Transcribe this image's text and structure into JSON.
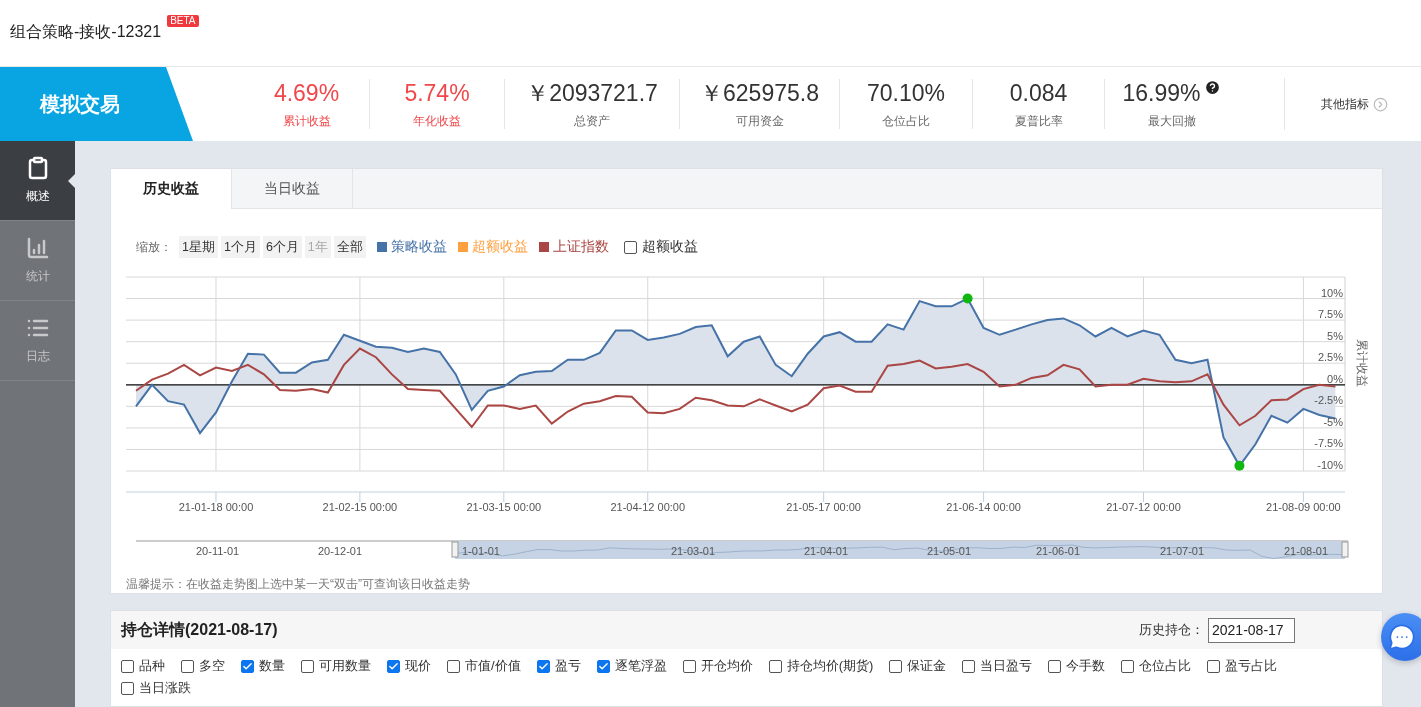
{
  "page": {
    "title": "组合策略-接收-12321",
    "badge": "BETA"
  },
  "banner": {
    "title": "模拟交易"
  },
  "metrics": [
    {
      "value": "4.69%",
      "label": "累计收益",
      "color": "#f0474a",
      "info": false
    },
    {
      "value": "5.74%",
      "label": "年化收益",
      "color": "#f0474a",
      "info": false
    },
    {
      "value": "￥2093721.7",
      "label": "总资产",
      "color": "#333333",
      "info": false
    },
    {
      "value": "￥625975.8",
      "label": "可用资金",
      "color": "#333333",
      "info": false
    },
    {
      "value": "70.10%",
      "label": "仓位占比",
      "color": "#333333",
      "info": false
    },
    {
      "value": "0.084",
      "label": "夏普比率",
      "color": "#333333",
      "info": false
    },
    {
      "value": "16.99%",
      "label": "最大回撤",
      "color": "#333333",
      "info": true
    }
  ],
  "other_metrics": {
    "label": "其他指标"
  },
  "sidebar": {
    "items": [
      {
        "label": "概述",
        "kind": "overview",
        "selected": true
      },
      {
        "label": "统计",
        "kind": "stats",
        "selected": false
      },
      {
        "label": "日志",
        "kind": "log",
        "selected": false
      }
    ]
  },
  "chart_panel": {
    "tabs": [
      {
        "label": "历史收益",
        "selected": true
      },
      {
        "label": "当日收益",
        "selected": false
      }
    ],
    "zoom": {
      "label": "缩放：",
      "buttons": [
        {
          "label": "1星期",
          "disabled": false
        },
        {
          "label": "1个月",
          "disabled": false
        },
        {
          "label": "6个月",
          "disabled": false
        },
        {
          "label": "1年",
          "disabled": true
        },
        {
          "label": "全部",
          "disabled": false
        }
      ]
    },
    "excess_toggle": {
      "label": "超额收益",
      "checked": false
    },
    "legend_extra": {
      "label": "超额收益",
      "color": "#ffa040"
    },
    "chart_data": {
      "type": "line",
      "ylabel": "累计收益",
      "grid": true,
      "categories": [
        null,
        null,
        null,
        null,
        null,
        "21-01-18 00:00",
        null,
        null,
        null,
        null,
        null,
        null,
        null,
        null,
        "21-02-15 00:00",
        null,
        null,
        null,
        null,
        null,
        null,
        null,
        null,
        "21-03-15 00:00",
        null,
        null,
        null,
        null,
        null,
        null,
        null,
        null,
        "21-04-12 00:00",
        null,
        null,
        null,
        null,
        null,
        null,
        null,
        null,
        null,
        null,
        "21-05-17 00:00",
        null,
        null,
        null,
        null,
        null,
        null,
        null,
        null,
        null,
        "21-06-14 00:00",
        null,
        null,
        null,
        null,
        null,
        null,
        null,
        null,
        null,
        "21-07-12 00:00",
        null,
        null,
        null,
        null,
        null,
        null,
        null,
        null,
        null,
        "21-08-09 00:00",
        null,
        null
      ],
      "ylim": [
        -10,
        12.5
      ],
      "yticks": [
        {
          "value": 10,
          "label": "10%"
        },
        {
          "value": 7.5,
          "label": "7.5%"
        },
        {
          "value": 5,
          "label": "5%"
        },
        {
          "value": 2.5,
          "label": "2.5%"
        },
        {
          "value": 0,
          "label": "0%"
        },
        {
          "value": -2.5,
          "label": "-2.5%"
        },
        {
          "value": -5,
          "label": "-5%"
        },
        {
          "value": -7.5,
          "label": "-7.5%"
        },
        {
          "value": -10,
          "label": "-10%"
        }
      ],
      "series": [
        {
          "name": "策略收益",
          "color": "#4572a7",
          "values": [
            -2.5,
            0,
            -1.9,
            -2.3,
            -5.6,
            -3.2,
            0.4,
            3.6,
            3.5,
            1.4,
            1.4,
            2.6,
            2.9,
            5.8,
            5.1,
            4.4,
            4.3,
            3.8,
            4.2,
            3.8,
            1.2,
            -2.9,
            -0.7,
            -0.2,
            1.1,
            1.5,
            1.6,
            2.9,
            2.9,
            3.7,
            6.3,
            6.3,
            5.2,
            5.5,
            5.9,
            6.7,
            6.9,
            3.3,
            5.0,
            5.6,
            2.3,
            1.0,
            3.6,
            5.6,
            6.1,
            5.0,
            5.0,
            7.0,
            6.4,
            9.7,
            9.1,
            9.1,
            10.0,
            6.6,
            5.8,
            6.4,
            7.0,
            7.5,
            7.7,
            6.9,
            5.6,
            6.6,
            5.6,
            6.3,
            5.8,
            2.9,
            2.5,
            2.9,
            -6.1,
            -9.4,
            -6.9,
            -3.6,
            -4.4,
            -2.8,
            -3.5,
            -3.9
          ]
        },
        {
          "name": "上证指数",
          "color": "#aa4643",
          "values": [
            -0.7,
            0.6,
            1.3,
            2.3,
            1.1,
            2.0,
            1.6,
            2.3,
            1.2,
            -0.6,
            -0.7,
            -0.5,
            -0.9,
            2.3,
            4.2,
            3.2,
            1.2,
            -0.5,
            -0.6,
            -0.7,
            -2.8,
            -4.9,
            -2.4,
            -2.4,
            -2.8,
            -2.4,
            -4.5,
            -3.1,
            -2.2,
            -1.9,
            -1.3,
            -1.4,
            -3.2,
            -3.3,
            -2.8,
            -1.5,
            -1.8,
            -2.4,
            -2.5,
            -1.7,
            -2.4,
            -3.1,
            -2.3,
            -0.4,
            -0.1,
            -0.8,
            -0.8,
            2.2,
            2.4,
            2.8,
            1.9,
            2.1,
            2.4,
            1.5,
            -0.2,
            0,
            0.8,
            1.1,
            2.3,
            1.8,
            -0.2,
            0,
            0,
            0.7,
            0.4,
            0.3,
            0.4,
            1.2,
            -2.3,
            -4.7,
            -3.6,
            -1.8,
            -1.7,
            -0.5,
            0,
            -0.2
          ]
        }
      ]
    },
    "navigator": {
      "labels": [
        "20-11-01",
        "20-12-01",
        "1-01-01",
        "21-03-01",
        "21-04-01",
        "21-05-01",
        "21-06-01",
        "21-07-01",
        "21-08-01"
      ]
    },
    "tip": "温馨提示：在收益走势图上选中某一天“双击”可查询该日收益走势"
  },
  "positions": {
    "title": "持仓详情(2021-08-17)",
    "history_label": "历史持仓：",
    "history_value": "2021-08-17",
    "columns": [
      {
        "label": "品种",
        "checked": false
      },
      {
        "label": "多空",
        "checked": false
      },
      {
        "label": "数量",
        "checked": true
      },
      {
        "label": "可用数量",
        "checked": false
      },
      {
        "label": "现价",
        "checked": true
      },
      {
        "label": "市值/价值",
        "checked": false
      },
      {
        "label": "盈亏",
        "checked": true
      },
      {
        "label": "逐笔浮盈",
        "checked": true
      },
      {
        "label": "开仓均价",
        "checked": false
      },
      {
        "label": "持仓均价(期货)",
        "checked": false
      },
      {
        "label": "保证金",
        "checked": false
      },
      {
        "label": "当日盈亏",
        "checked": false
      },
      {
        "label": "今手数",
        "checked": false
      },
      {
        "label": "仓位占比",
        "checked": false
      },
      {
        "label": "盈亏占比",
        "checked": false
      },
      {
        "label": "当日涨跌",
        "checked": false
      }
    ]
  }
}
